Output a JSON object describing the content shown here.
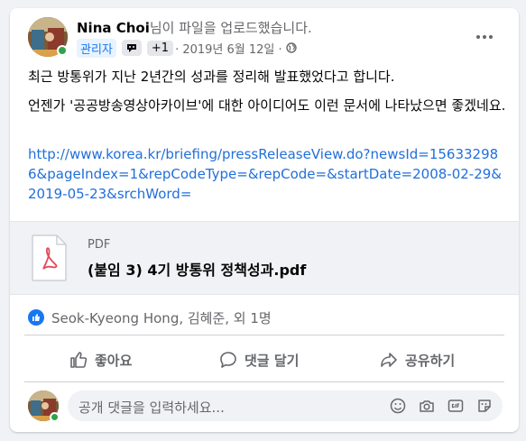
{
  "post": {
    "author_name": "Nina Choi",
    "author_action": "님이 파일을 업로드했습니다.",
    "role_badge": "관리자",
    "plus_count": "+1",
    "date": "· 2019년 6월 12일 ·",
    "paragraphs": [
      "최근 방통위가 지난 2년간의 성과를 정리해 발표했었다고 합니다.",
      "언젠가 '공공방송영상아카이브'에 대한 아이디어도 이런 문서에 나타났으면 좋겠네요."
    ],
    "link_text": "http://www.korea.kr/briefing/pressReleaseView.do?newsId=156332986&pageIndex=1&repCodeType=&repCode=&startDate=2008-02-29&2019-05-23&srchWord="
  },
  "attachment": {
    "file_type": "PDF",
    "file_name": "(붙임 3) 4기 방통위 정책성과.pdf"
  },
  "reactions": {
    "summary": "Seok-Kyeong Hong, 김혜준, 외 1명"
  },
  "actions": {
    "like_label": "좋아요",
    "comment_label": "댓글 달기",
    "share_label": "공유하기"
  },
  "comment": {
    "placeholder": "공개 댓글을 입력하세요..."
  },
  "icons": {
    "like": "thumbs-up-icon",
    "comment": "speech-bubble-icon",
    "share": "share-arrow-icon",
    "globe": "globe-icon",
    "more": "ellipsis-icon"
  },
  "colors": {
    "accent": "#1877f2",
    "link": "#216fdb",
    "online": "#31a24c",
    "pdf_red": "#e1485a"
  }
}
